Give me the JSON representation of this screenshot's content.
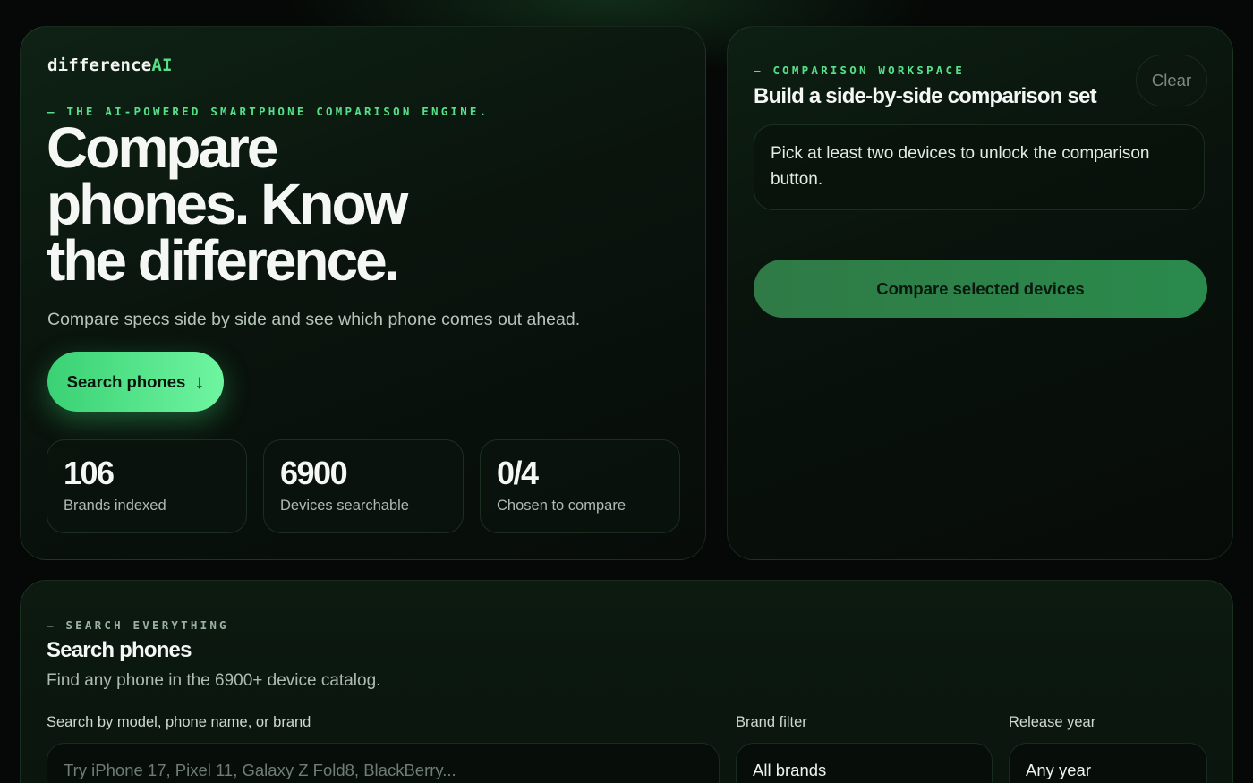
{
  "brand": {
    "name": "difference",
    "suffix": "AI"
  },
  "hero": {
    "eyebrow": "— THE AI-POWERED SMARTPHONE COMPARISON ENGINE.",
    "headline": "Compare phones. Know the difference.",
    "subline": "Compare specs side by side and see which phone comes out ahead.",
    "cta_label": "Search phones",
    "cta_icon": "↓",
    "stats": [
      {
        "value": "106",
        "label": "Brands indexed"
      },
      {
        "value": "6900",
        "label": "Devices searchable"
      },
      {
        "value": "0/4",
        "label": "Chosen to compare"
      }
    ]
  },
  "workspace": {
    "eyebrow": "— COMPARISON WORKSPACE",
    "title": "Build a side-by-side comparison set",
    "clear_label": "Clear",
    "hint": "Pick at least two devices to unlock the comparison button.",
    "compare_label": "Compare selected devices"
  },
  "search": {
    "eyebrow": "— SEARCH EVERYTHING",
    "title": "Search phones",
    "subtitle": "Find any phone in the 6900+ device catalog.",
    "query_label": "Search by model, phone name, or brand",
    "query_placeholder": "Try iPhone 17, Pixel 11, Galaxy Z Fold8, BlackBerry...",
    "query_value": "",
    "brand_label": "Brand filter",
    "brand_value": "All brands",
    "year_label": "Release year",
    "year_value": "Any year"
  },
  "colors": {
    "accent": "#57e08a",
    "background": "#050806",
    "button_dark": "#2f7a46"
  }
}
